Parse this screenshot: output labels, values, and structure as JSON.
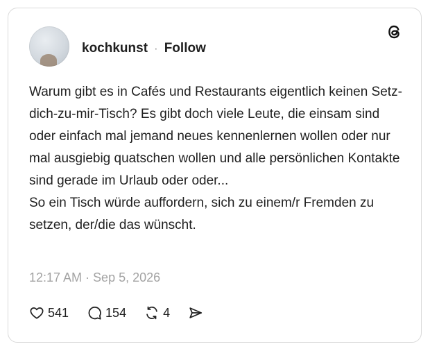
{
  "post": {
    "username": "kochkunst",
    "separator": "·",
    "follow_label": "Follow",
    "paragraph1": "Warum gibt es in Cafés und Restaurants eigentlich keinen Setz-dich-zu-mir-Tisch? Es gibt doch viele Leute, die einsam sind oder einfach mal jemand neues kennenlernen wollen oder nur mal ausgiebig quatschen wollen und alle persönlichen Kontakte sind gerade im Urlaub oder oder...",
    "paragraph2": "So ein Tisch würde auffordern, sich zu einem/r Fremden zu setzen, der/die das wünscht.",
    "timestamp": "12:17 AM · Sep 5, 2026"
  },
  "actions": {
    "likes": "541",
    "replies": "154",
    "reposts": "4"
  },
  "icons": {
    "logo": "threads-logo-icon",
    "like": "heart-icon",
    "reply": "comment-bubble-icon",
    "repost": "repost-icon",
    "share": "send-icon"
  },
  "colors": {
    "text": "#1f1f1f",
    "muted": "#a3a3a3",
    "border": "#d9d9d9"
  }
}
